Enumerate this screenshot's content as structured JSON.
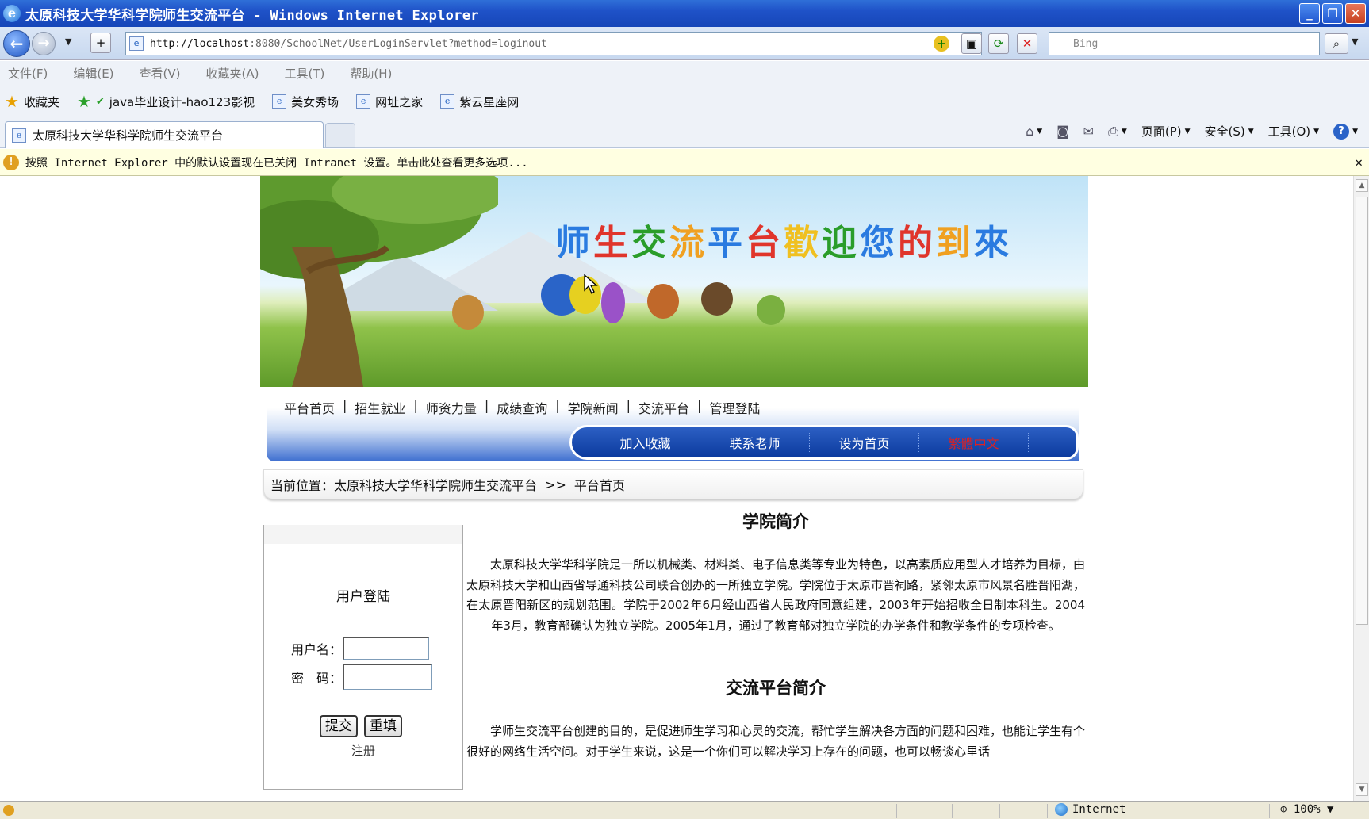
{
  "window": {
    "title": "太原科技大学华科学院师生交流平台 - Windows Internet Explorer",
    "ie_glyph": "e",
    "min": "_",
    "max": "❐",
    "close": "✕"
  },
  "address": {
    "url_host": "http://localhost",
    "url_rest": ":8080/SchoolNet/UserLoginServlet?method=loginout",
    "search_placeholder": "Bing"
  },
  "menu": [
    "文件(F)",
    "编辑(E)",
    "查看(V)",
    "收藏夹(A)",
    "工具(T)",
    "帮助(H)"
  ],
  "favorites": {
    "label": "收藏夹",
    "items": [
      "java毕业设计-hao123影视",
      "美女秀场",
      "网址之家",
      "紫云星座网"
    ]
  },
  "tab": {
    "label": "太原科技大学华科学院师生交流平台"
  },
  "command_bar": {
    "page": "页面(P)",
    "safety": "安全(S)",
    "tools": "工具(O)"
  },
  "infobar": {
    "text": "按照 Internet Explorer 中的默认设置现在已关闭 Intranet 设置。单击此处查看更多选项..."
  },
  "banner": {
    "title_chars": [
      "师",
      "生",
      "交",
      "流",
      "平",
      "台",
      "歡",
      "迎",
      "您",
      "的",
      "到",
      "來"
    ],
    "title_colors": [
      "#2a7be0",
      "#e0352b",
      "#2a9d2a",
      "#f0a020",
      "#2a7be0",
      "#e0352b",
      "#f0c020",
      "#2a9d2a",
      "#2a7be0",
      "#e0352b",
      "#f0a020",
      "#2a7be0"
    ]
  },
  "nav": {
    "links": [
      "平台首页",
      "招生就业",
      "师资力量",
      "成绩查询",
      "学院新闻",
      "交流平台",
      "管理登陆"
    ],
    "sep": "|",
    "buttons": [
      "加入收藏",
      "联系老师",
      "设为首页",
      "繁體中文"
    ]
  },
  "breadcrumb": {
    "label": "当前位置：",
    "site": "太原科技大学华科学院师生交流平台",
    "sep": ">>",
    "current": "平台首页"
  },
  "login": {
    "title": "用户登陆",
    "username_label": "用户名：",
    "password_label": "密　码：",
    "submit": "提交",
    "reset": "重填",
    "register": "注册"
  },
  "content": {
    "intro_title": "学院简介",
    "intro_text": "太原科技大学华科学院是一所以机械类、材料类、电子信息类等专业为特色，以高素质应用型人才培养为目标，由太原科技大学和山西省导通科技公司联合创办的一所独立学院。学院位于太原市晋祠路，紧邻太原市风景名胜晋阳湖，在太原晋阳新区的规划范围。学院于2002年6月经山西省人民政府同意组建，2003年开始招收全日制本科生。2004年3月，教育部确认为独立学院。2005年1月，通过了教育部对独立学院的办学条件和教学条件的专项检查。",
    "platform_title": "交流平台简介",
    "platform_text": "学师生交流平台创建的目的，是促进师生学习和心灵的交流，帮忙学生解决各方面的问题和困难，也能让学生有个很好的网络生活空间。对于学生来说，这是一个你们可以解决学习上存在的问题，也可以畅谈心里话"
  },
  "status": {
    "zone": "Internet",
    "zoom": "100%"
  }
}
